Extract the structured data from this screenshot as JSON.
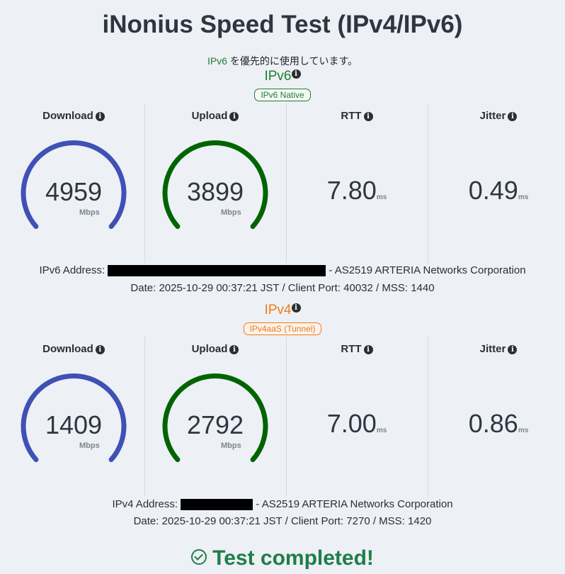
{
  "title": "iNonius Speed Test (IPv4/IPv6)",
  "pref_note": {
    "proto": "IPv6",
    "text": " を優先的に使用しています。"
  },
  "labels": {
    "download": "Download",
    "upload": "Upload",
    "rtt": "RTT",
    "jitter": "Jitter",
    "mbps": "Mbps",
    "ms": "ms"
  },
  "ipv6": {
    "title": "IPv6",
    "badge": "IPv6 Native",
    "download": "4959",
    "upload": "3899",
    "rtt": "7.80",
    "jitter": "0.49",
    "address_label": "IPv6 Address:",
    "address_suffix": " - AS2519 ARTERIA Networks Corporation",
    "date_line": "Date: 2025-10-29 00:37:21 JST / Client Port: 40032 / MSS: 1440"
  },
  "ipv4": {
    "title": "IPv4",
    "badge": "IPv4aaS (Tunnel)",
    "download": "1409",
    "upload": "2792",
    "rtt": "7.00",
    "jitter": "0.86",
    "address_label": "IPv4 Address:",
    "address_suffix": " - AS2519 ARTERIA Networks Corporation",
    "date_line": "Date: 2025-10-29 00:37:21 JST / Client Port: 7270 / MSS: 1420"
  },
  "status": "Test completed!",
  "colors": {
    "download_gauge": "#3f51b5",
    "upload_gauge": "#006400",
    "ipv6": "#1e7e34",
    "ipv4": "#f07b1a",
    "complete": "#1e7e4a"
  }
}
